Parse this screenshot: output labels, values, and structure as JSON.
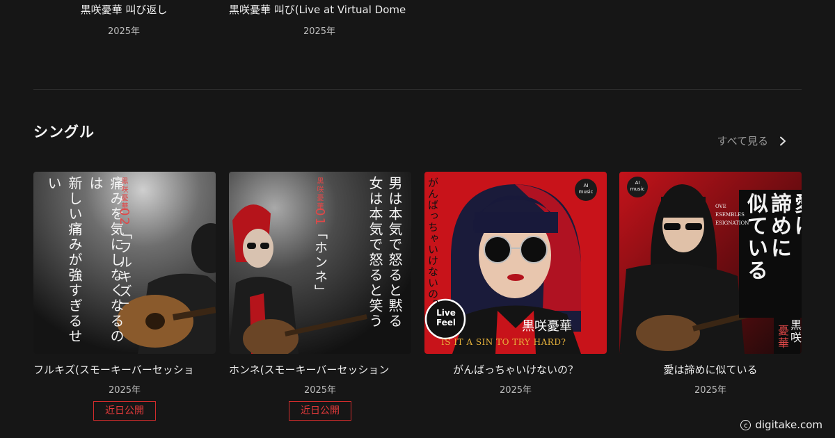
{
  "previous_section": {
    "items": [
      {
        "title": "黒咲憂華 叫び返し",
        "year": "2025年"
      },
      {
        "title": "黒咲憂華 叫び(Live at Virtual Dome",
        "year": "2025年"
      }
    ]
  },
  "singles": {
    "heading": "シングル",
    "see_all_label": "すべて見る",
    "items": [
      {
        "title": "フルキズ(スモーキーバーセッショ",
        "year": "2025年",
        "badge": "近日公開",
        "art": {
          "lyric_line_1": "痛みを気にしなくなるのは",
          "lyric_line_2": "新しい痛みが強すぎるせい",
          "artist": "黒咲憂華",
          "number": "02",
          "song": "「フルキズ」"
        }
      },
      {
        "title": "ホンネ(スモーキーバーセッション",
        "year": "2025年",
        "badge": "近日公開",
        "art": {
          "lyric_line_1": "男は本気で怒ると黙る",
          "lyric_line_2": "女は本気で怒ると笑う",
          "artist": "黒咲憂華",
          "number": "01",
          "song": "「ホンネ」"
        }
      },
      {
        "title": "がんばっちゃいけないの？",
        "year": "2025年",
        "art": {
          "vertical_title": "がんばっちゃいけないの？",
          "badge_line_1": "Live",
          "badge_line_2": "Feel",
          "label_line_1": "AI",
          "label_line_2": "music",
          "artist": "黒咲憂華",
          "subtitle": "IS IT A SIN TO TRY HARD?"
        }
      },
      {
        "title": "愛は諦めに似ている",
        "year": "2025年",
        "art": {
          "big_title_1": "愛は",
          "big_title_2": "諦めに",
          "big_title_3": "似ている",
          "acronym_1": "OVE",
          "acronym_2": "ESEMBLES",
          "acronym_3": "ESIGNATION",
          "label_line_1": "AI",
          "label_line_2": "music",
          "artist_1": "黒咲",
          "artist_2": "憂華"
        }
      }
    ]
  },
  "watermark": "digitake.com",
  "colors": {
    "background": "#161616",
    "badge_red": "#d12c2c",
    "art_red": "#c8131a"
  }
}
